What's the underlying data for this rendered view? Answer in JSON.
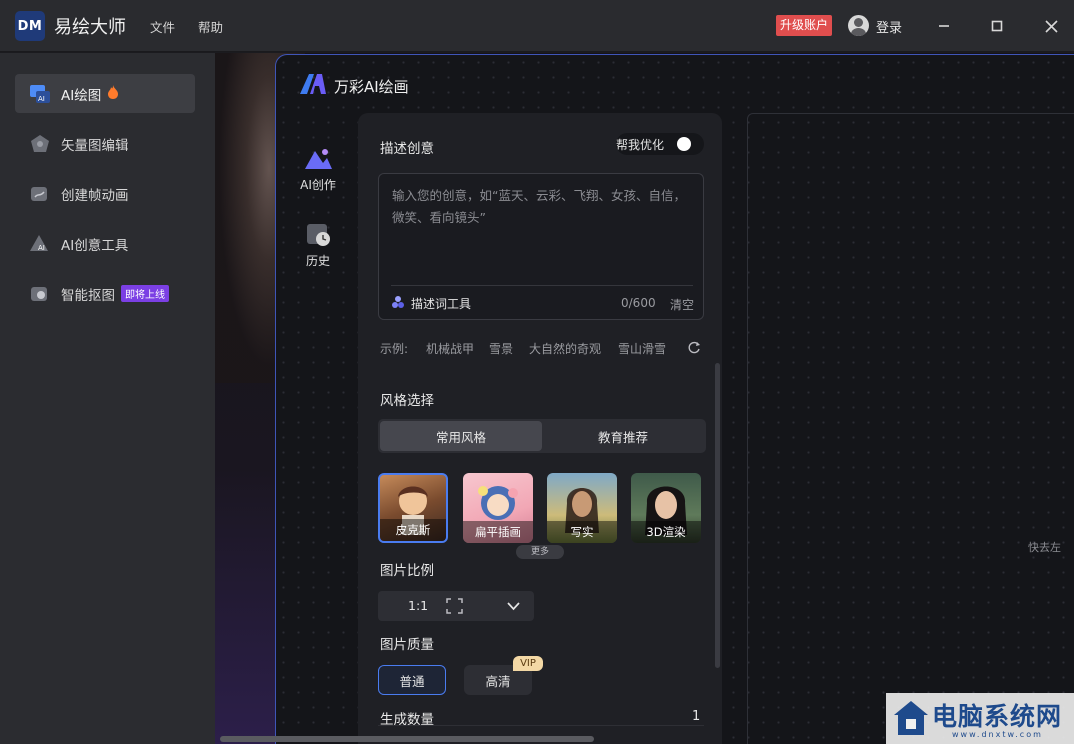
{
  "titlebar": {
    "logo_text": "DM",
    "app_title": "易绘大师",
    "menu": [
      "文件",
      "帮助"
    ],
    "upgrade_label": "升级账户",
    "login_label": "登录"
  },
  "sidebar": {
    "items": [
      {
        "label": "AI绘图",
        "icon": "ai-draw-icon",
        "active": true
      },
      {
        "label": "矢量图编辑",
        "icon": "vector-edit-icon"
      },
      {
        "label": "创建帧动画",
        "icon": "frame-animation-icon"
      },
      {
        "label": "AI创意工具",
        "icon": "ai-creative-tool-icon"
      },
      {
        "label": "智能抠图",
        "icon": "smart-cutout-icon",
        "badge": "即将上线"
      }
    ]
  },
  "panel": {
    "title": "万彩AI绘画",
    "tabs": [
      {
        "label": "AI创作",
        "icon": "mountain-icon"
      },
      {
        "label": "历史",
        "icon": "history-icon"
      }
    ],
    "describe": {
      "label": "描述创意",
      "optimize_label": "帮我优化",
      "placeholder": "输入您的创意，如“蓝天、云彩、飞翔、女孩、自信，微笑、看向镜头”",
      "tool_label": "描述词工具",
      "counter": "0/600",
      "clear_label": "清空"
    },
    "examples": {
      "prefix": "示例:",
      "items": [
        "机械战甲",
        "雪景",
        "大自然的奇观",
        "雪山滑雪"
      ]
    },
    "style": {
      "label": "风格选择",
      "tabs": [
        "常用风格",
        "教育推荐"
      ],
      "cards": [
        "皮克斯",
        "扁平插画",
        "写实",
        "3D渲染"
      ],
      "more_label": "更多"
    },
    "ratio": {
      "label": "图片比例",
      "value": "1:1"
    },
    "quality": {
      "label": "图片质量",
      "options": [
        "普通",
        "高清"
      ],
      "vip_label": "VIP"
    },
    "count": {
      "label": "生成数量",
      "value": "1"
    },
    "canvas_hint": "快去左"
  },
  "watermark": {
    "text": "电脑系统网",
    "sub": "www.dnxtw.com"
  },
  "colors": {
    "accent_blue": "#4a7cf0",
    "upgrade_red": "#e04e4e",
    "badge_purple": "#7b3fe4"
  }
}
